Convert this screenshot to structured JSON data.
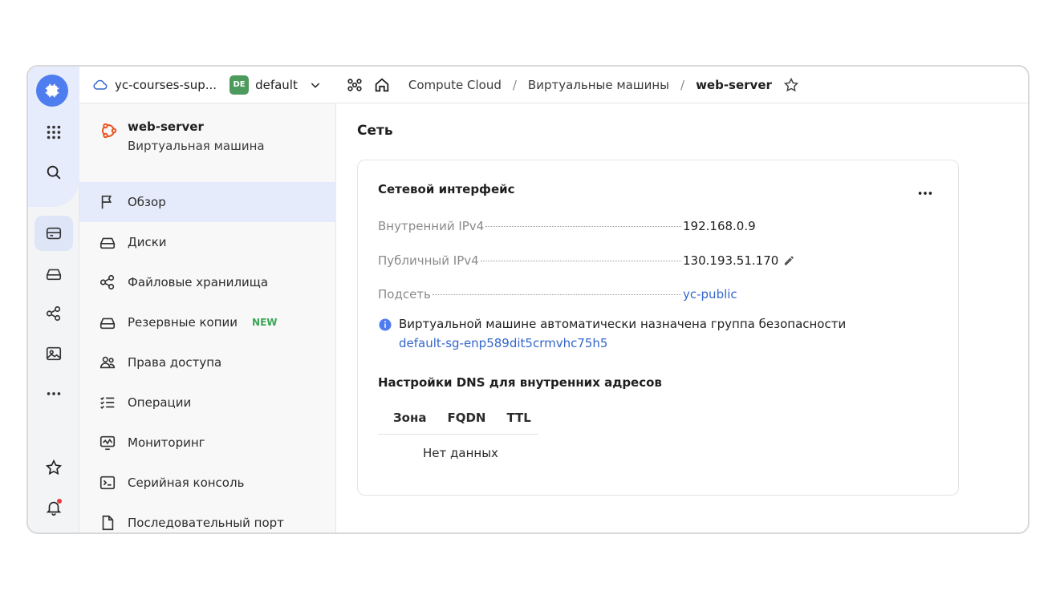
{
  "topbar": {
    "cloud_name": "yc-courses-sup...",
    "folder_badge": "DE",
    "folder_name": "default",
    "breadcrumbs": [
      {
        "label": "Compute Cloud"
      },
      {
        "label": "Виртуальные машины"
      },
      {
        "label": "web-server"
      }
    ],
    "separator": "/"
  },
  "vm": {
    "name": "web-server",
    "type": "Виртуальная машина"
  },
  "nav": {
    "items": [
      {
        "label": "Обзор",
        "icon": "flag-icon"
      },
      {
        "label": "Диски",
        "icon": "disk-icon"
      },
      {
        "label": "Файловые хранилища",
        "icon": "share-nodes-icon"
      },
      {
        "label": "Резервные копии",
        "icon": "backup-icon",
        "badge": "NEW"
      },
      {
        "label": "Права доступа",
        "icon": "users-icon"
      },
      {
        "label": "Операции",
        "icon": "list-check-icon"
      },
      {
        "label": "Мониторинг",
        "icon": "monitor-chart-icon"
      },
      {
        "label": "Серийная консоль",
        "icon": "terminal-icon"
      },
      {
        "label": "Последовательный порт",
        "icon": "file-icon"
      }
    ]
  },
  "main": {
    "section_title": "Сеть",
    "card": {
      "title": "Сетевой интерфейс",
      "rows": [
        {
          "label": "Внутренний IPv4",
          "value": "192.168.0.9"
        },
        {
          "label": "Публичный IPv4",
          "value": "130.193.51.170"
        },
        {
          "label": "Подсеть",
          "value": "yc-public"
        }
      ],
      "info_text": "Виртуальной машине автоматически назначена группа безопасности",
      "info_link": "default-sg-enp589dit5crmvhc75h5",
      "dns_title": "Настройки DNS для внутренних адресов",
      "dns_columns": [
        "Зона",
        "FQDN",
        "TTL"
      ],
      "empty_text": "Нет данных"
    }
  },
  "colors": {
    "accent": "#4e7df0",
    "link": "#3366cc",
    "active_nav": "#e5ebfa",
    "new_badge": "#3aa655",
    "folder_badge": "#4c9a5c"
  }
}
